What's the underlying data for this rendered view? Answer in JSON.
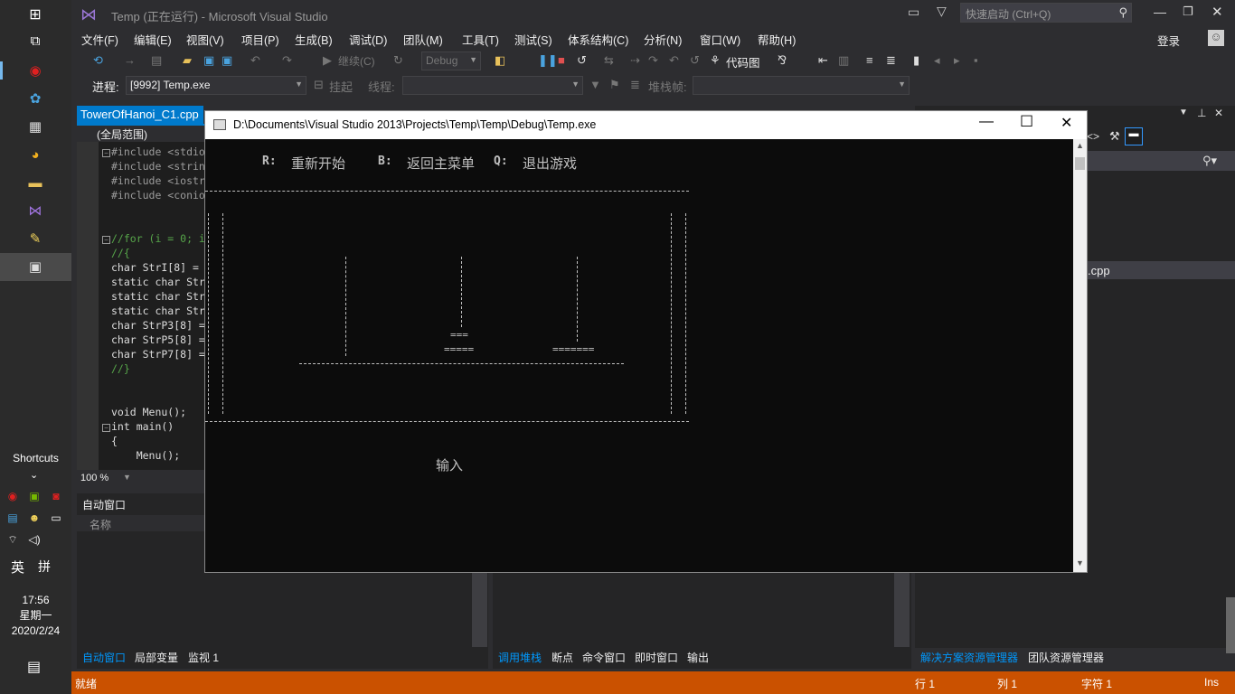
{
  "taskbar": {
    "shortcuts_label": "Shortcuts",
    "lang_en": "英",
    "lang_grid": "拼",
    "clock_time": "17:56",
    "clock_weekday": "星期一",
    "clock_date": "2020/2/24"
  },
  "vs": {
    "title": "Temp (正在运行) - Microsoft Visual Studio",
    "quicklaunch_placeholder": "快速启动 (Ctrl+Q)",
    "menus": [
      "文件(F)",
      "编辑(E)",
      "视图(V)",
      "项目(P)",
      "生成(B)",
      "调试(D)",
      "团队(M)",
      "工具(T)",
      "测试(S)",
      "体系结构(C)",
      "分析(N)",
      "窗口(W)",
      "帮助(H)"
    ],
    "login": "登录",
    "toolbar": {
      "continue_label": "继续(C)",
      "config": "Debug",
      "codemap_label": "代码图",
      "process_label": "进程:",
      "process_value": "[9992] Temp.exe",
      "suspend_label": "挂起",
      "thread_label": "线程:",
      "stackframe_label": "堆栈帧:"
    },
    "editor": {
      "tab": "TowerOfHanoi_C1.cpp",
      "scope": "(全局范围)",
      "zoom": "100 %",
      "lines": [
        {
          "pre": "#include <stdio",
          "cls": "pp"
        },
        {
          "pre": "#include <strin",
          "cls": "pp"
        },
        {
          "pre": "#include <iostr",
          "cls": "pp"
        },
        {
          "pre": "#include <conio",
          "cls": "pp"
        },
        {
          "pre": "//for (i = 0; i",
          "cls": "cm"
        },
        {
          "pre": "//{",
          "cls": "cm"
        },
        {
          "pre": "char StrI[8] =",
          "cls": "code"
        },
        {
          "pre": "static char Str",
          "cls": "code"
        },
        {
          "pre": "static char Str",
          "cls": "code"
        },
        {
          "pre": "static char Str",
          "cls": "code"
        },
        {
          "pre": "char StrP3[8] =",
          "cls": "code"
        },
        {
          "pre": "char StrP5[8] =",
          "cls": "code"
        },
        {
          "pre": "char StrP7[8] =",
          "cls": "code"
        },
        {
          "pre": "//}",
          "cls": "cm"
        },
        {
          "pre": "void Menu();",
          "cls": "code"
        },
        {
          "pre": "int main()",
          "cls": "code"
        },
        {
          "pre": "{",
          "cls": "code"
        },
        {
          "pre": "    Menu();",
          "cls": "code"
        }
      ]
    },
    "auto_panel": {
      "title": "自动窗口",
      "col_name": "名称",
      "tabs": [
        "自动窗口",
        "局部变量",
        "监视 1"
      ]
    },
    "callstack_panel": {
      "tabs": [
        "调用堆栈",
        "断点",
        "命令窗口",
        "即时窗口",
        "输出"
      ]
    },
    "solution_panel": {
      "file_suffix": ".cpp",
      "tabs": [
        "解决方案资源管理器",
        "团队资源管理器"
      ]
    },
    "status": {
      "ready": "就绪",
      "row": "行 1",
      "col": "列 1",
      "char": "字符 1",
      "ins": "Ins"
    }
  },
  "console": {
    "title": "D:\\Documents\\Visual Studio 2013\\Projects\\Temp\\Temp\\Debug\\Temp.exe",
    "menu": [
      {
        "key": "R:",
        "label": "重新开始"
      },
      {
        "key": "B:",
        "label": "返回主菜单"
      },
      {
        "key": "Q:",
        "label": "退出游戏"
      }
    ],
    "disks": [
      "===",
      "=====",
      "======="
    ],
    "input_label": "输入"
  }
}
